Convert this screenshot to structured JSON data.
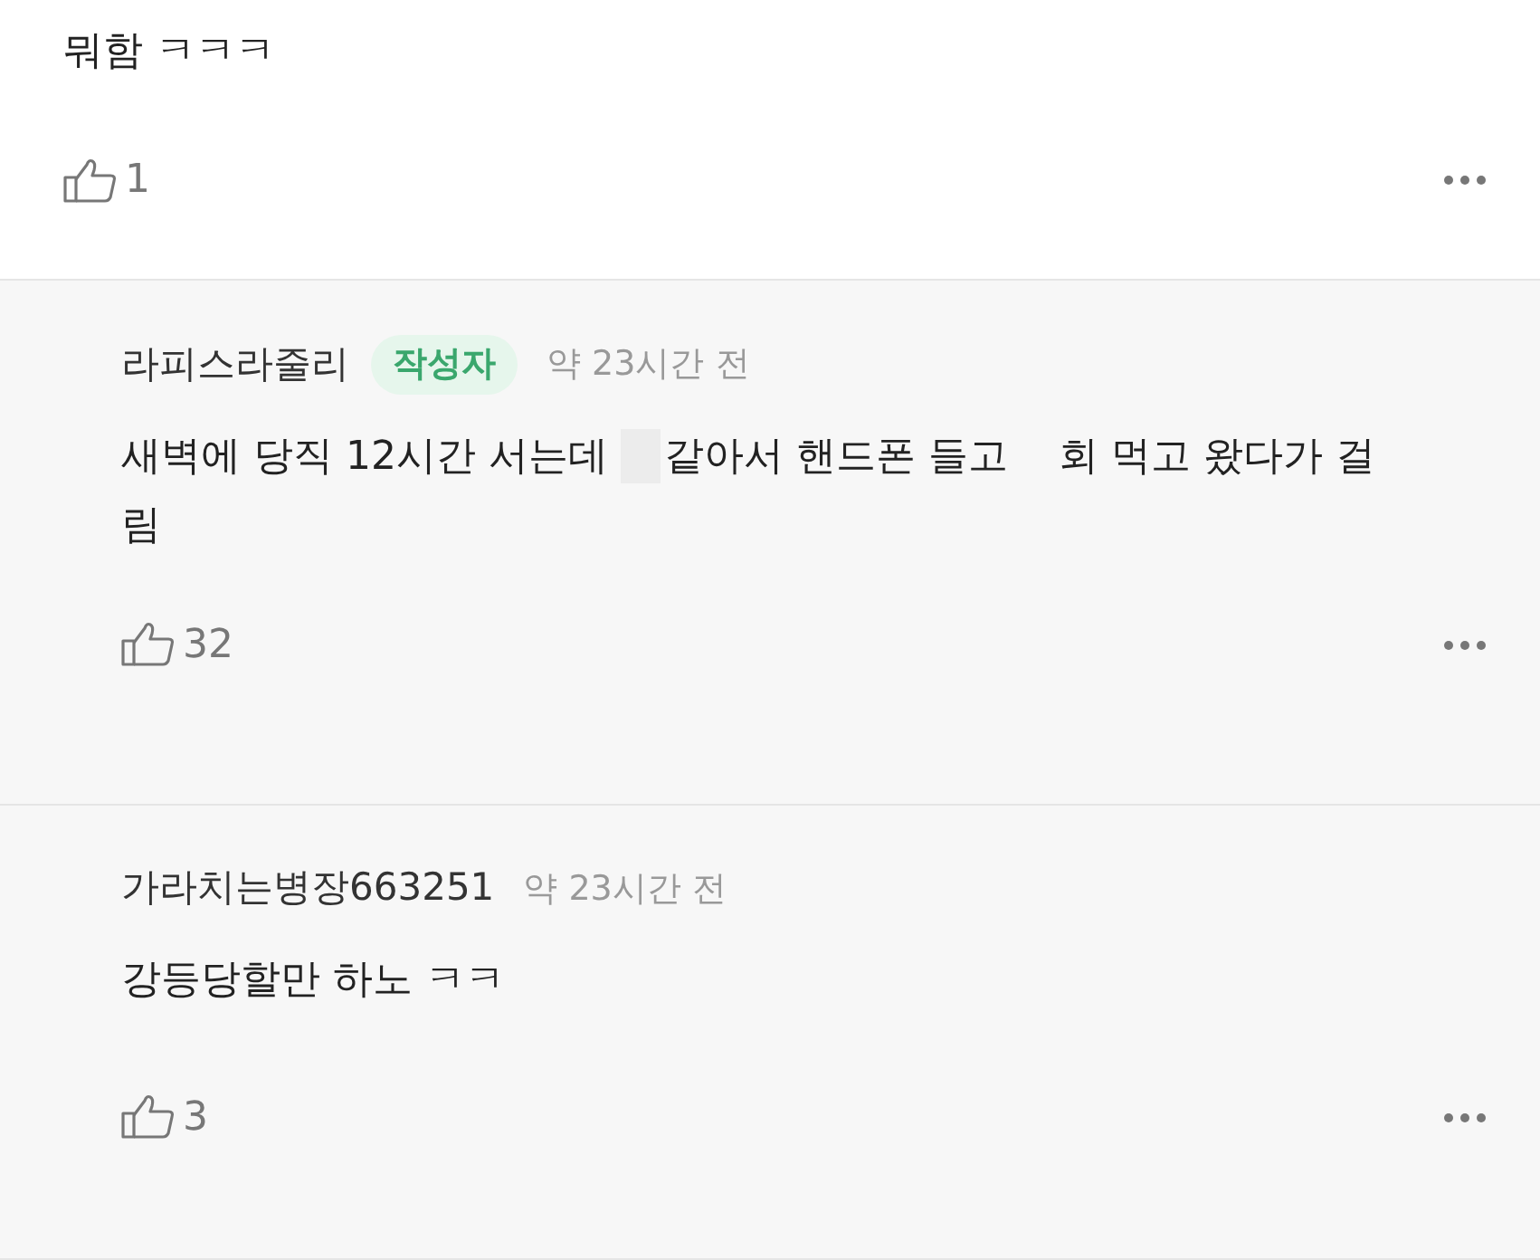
{
  "comment": {
    "body": "뭐함 ㅋㅋㅋ",
    "likes": "1"
  },
  "replies": [
    {
      "author": "라피스라줄리",
      "badge": "작성자",
      "time": "약 23시간 전",
      "segments": [
        {
          "kind": "text",
          "text": "새벽에 당직 12시간 서는데 "
        },
        {
          "kind": "redaction"
        },
        {
          "kind": "text",
          "text": "같아서 핸드폰 들고    회 먹고 왔다가 걸림"
        }
      ],
      "likes": "32"
    },
    {
      "author": "가라치는병장663251",
      "time": "약 23시간 전",
      "segments": [
        {
          "kind": "text",
          "text": "강등당할만 하노 ㅋㅋ"
        }
      ],
      "likes": "3"
    }
  ]
}
